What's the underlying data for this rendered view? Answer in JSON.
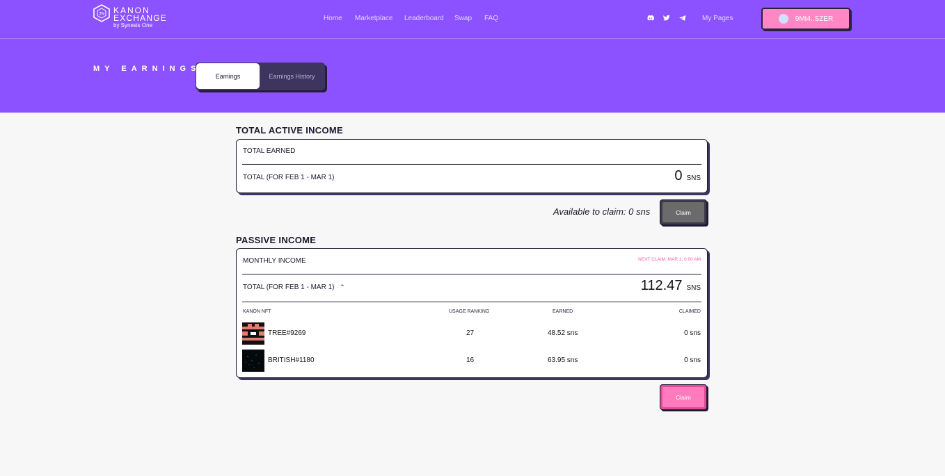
{
  "header": {
    "logo_line1": "KANON",
    "logo_line2": "EXCHANGE",
    "logo_byline": "by Synesis One",
    "nav": [
      "Home",
      "Marketplace",
      "Leaderboard",
      "Swap",
      "FAQ"
    ],
    "social_icons": [
      "discord-icon",
      "twitter-icon",
      "telegram-icon"
    ],
    "my_pages": "My Pages",
    "wallet": "9Mt4..SZER"
  },
  "page": {
    "title": "MY EARNINGS",
    "tabs": [
      {
        "label": "Earnings",
        "active": true
      },
      {
        "label": "Earnings History",
        "active": false
      }
    ]
  },
  "active_income": {
    "section_title": "TOTAL ACTIVE INCOME",
    "total_earned_label": "TOTAL EARNED",
    "period_label": "TOTAL (FOR FEB 1 - MAR 1)",
    "amount": "0",
    "unit": "SNS",
    "available_text": "Available to claim: 0 sns",
    "claim_label": "Claim"
  },
  "passive_income": {
    "section_title": "PASSIVE INCOME",
    "monthly_label": "MONTHLY INCOME",
    "next_claim": "NEXT CLAIM: MAR 1, 0:00 AM",
    "period_label": "TOTAL (FOR FEB 1 - MAR 1)",
    "amount": "112.47",
    "unit": "SNS",
    "columns": [
      "KANON NFT",
      "USAGE RANKING",
      "EARNED",
      "CLAIMED"
    ],
    "rows": [
      {
        "nft": "TREE#9269",
        "ranking": "27",
        "earned": "48.52 sns",
        "claimed": "0 sns"
      },
      {
        "nft": "BRITISH#1180",
        "ranking": "16",
        "earned": "63.95 sns",
        "claimed": "0 sns"
      }
    ],
    "claim_label": "Claim"
  },
  "colors": {
    "header_bg": "#8c52ff",
    "accent_pink": "#ff88c4",
    "dark_border": "#1f1b33"
  }
}
